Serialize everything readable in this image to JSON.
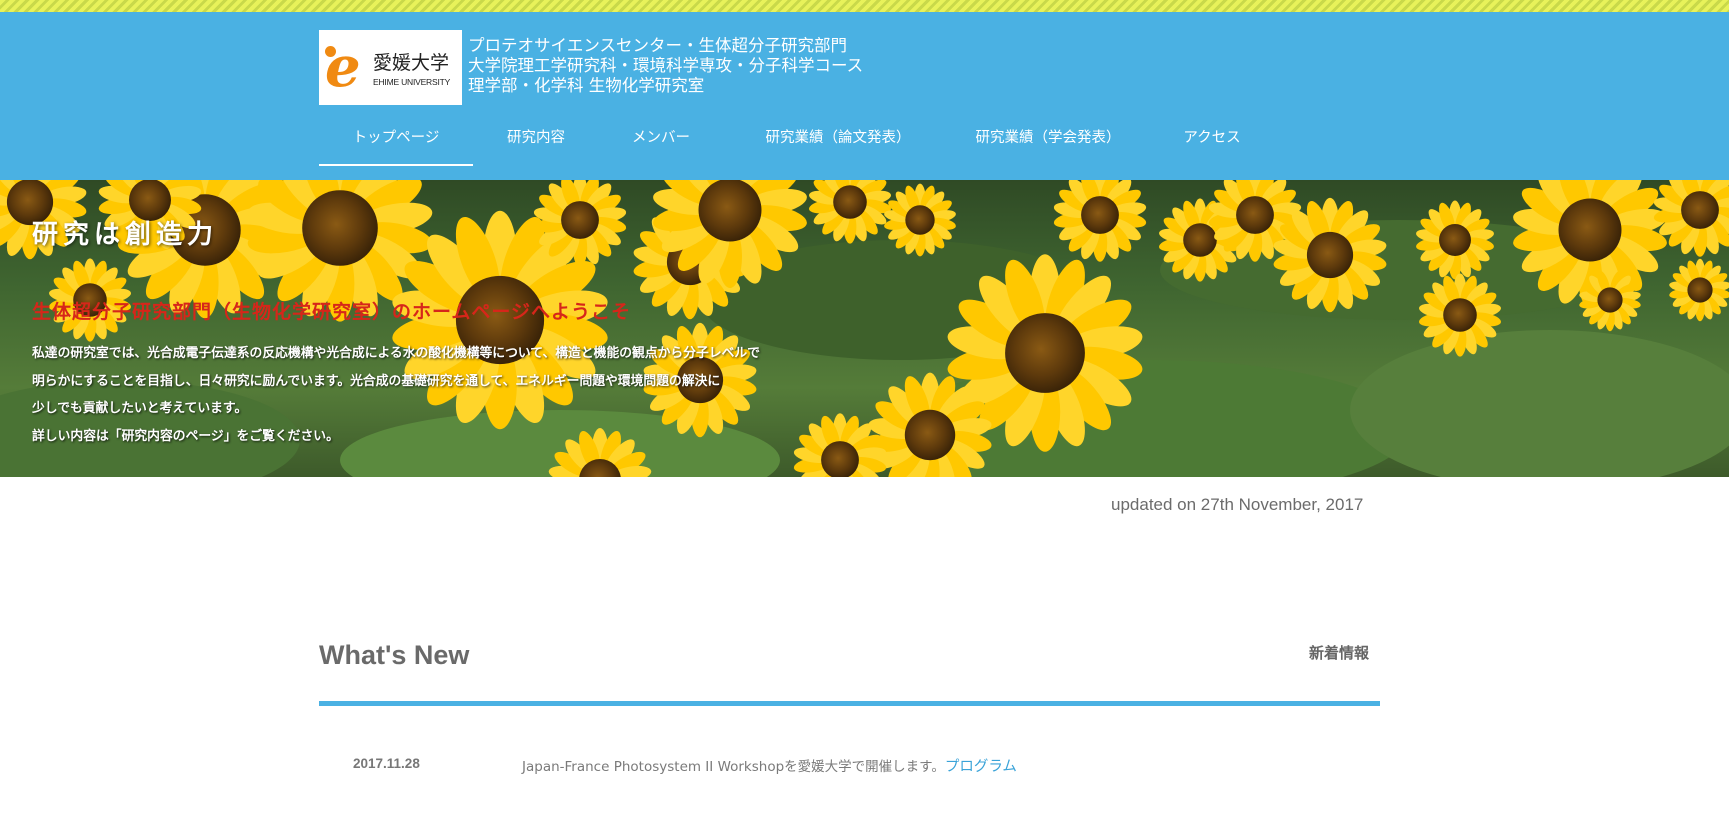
{
  "header": {
    "logo": {
      "name": "愛媛大学",
      "subname": "EHIME UNIVERSITY"
    },
    "lab_lines": [
      "プロテオサイエンスセンター・生体超分子研究部門",
      "大学院理工学研究科・環境科学専攻・分子科学コース",
      "理学部・化学科 生物化学研究室"
    ],
    "nav": [
      {
        "label": "トップページ",
        "active": true
      },
      {
        "label": "研究内容"
      },
      {
        "label": "メンバー"
      },
      {
        "label": "研究業績（論文発表）"
      },
      {
        "label": "研究業績（学会発表）"
      },
      {
        "label": "アクセス"
      }
    ],
    "brand_color": "#4ab1e3",
    "accent_stripe_color": "#e8f25a"
  },
  "hero": {
    "title": "研究は創造力",
    "welcome": "生体超分子研究部門（生物化学研究室）のホームページへようこそ",
    "body_lines": [
      "私達の研究室では、光合成電子伝達系の反応機構や光合成による水の酸化機構等について、構造と機能の観点から分子レベルで",
      "明らかにすることを目指し、日々研究に励んでいます。光合成の基礎研究を通して、エネルギー問題や環境問題の解決に",
      "少しでも貢献したいと考えています。",
      "詳しい内容は「研究内容のページ」をご覧ください。"
    ],
    "welcome_color": "#d6261a"
  },
  "updated": "updated on 27th November, 2017",
  "news": {
    "heading": "What's New",
    "heading_ja": "新着情報",
    "items": [
      {
        "date": "2017.11.28",
        "text": "Japan-France Photosystem II Workshopを愛媛大学で開催します。",
        "link": "プログラム"
      }
    ]
  }
}
